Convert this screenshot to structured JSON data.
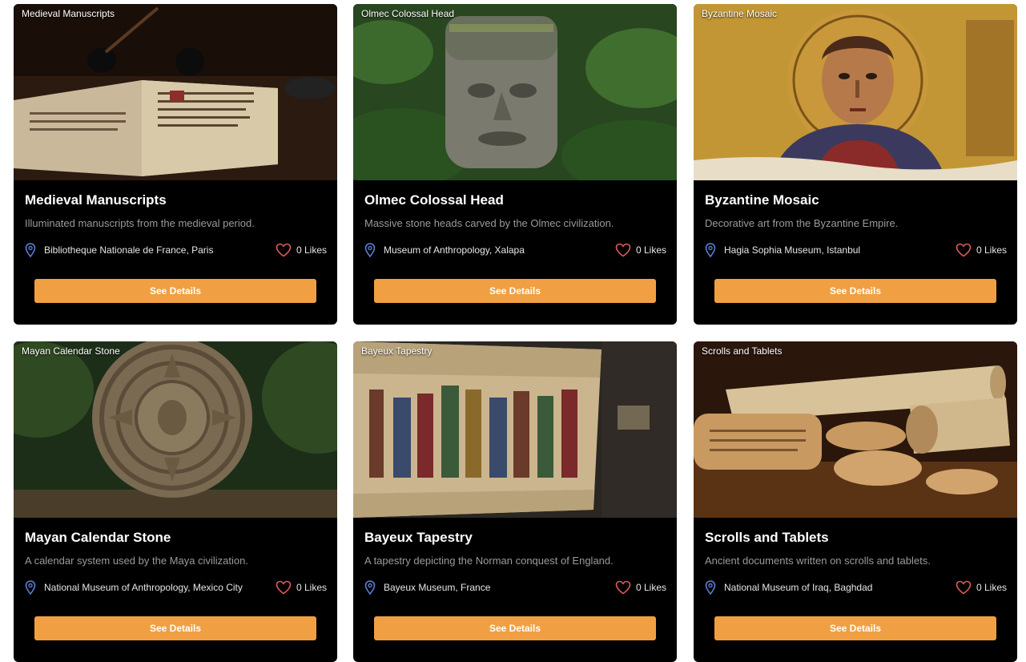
{
  "cards": [
    {
      "tag": "Medieval Manuscripts",
      "title": "Medieval Manuscripts",
      "description": "Illuminated manuscripts from the medieval period.",
      "location": "Bibliotheque Nationale de France, Paris",
      "likes": "0 Likes",
      "button": "See Details"
    },
    {
      "tag": "Olmec Colossal Head",
      "title": "Olmec Colossal Head",
      "description": "Massive stone heads carved by the Olmec civilization.",
      "location": "Museum of Anthropology, Xalapa",
      "likes": "0 Likes",
      "button": "See Details"
    },
    {
      "tag": "Byzantine Mosaic",
      "title": "Byzantine Mosaic",
      "description": "Decorative art from the Byzantine Empire.",
      "location": "Hagia Sophia Museum, Istanbul",
      "likes": "0 Likes",
      "button": "See Details"
    },
    {
      "tag": "Mayan Calendar Stone",
      "title": "Mayan Calendar Stone",
      "description": "A calendar system used by the Maya civilization.",
      "location": "National Museum of Anthropology, Mexico City",
      "likes": "0 Likes",
      "button": "See Details"
    },
    {
      "tag": "Bayeux Tapestry",
      "title": "Bayeux Tapestry",
      "description": "A tapestry depicting the Norman conquest of England.",
      "location": "Bayeux Museum, France",
      "likes": "0 Likes",
      "button": "See Details"
    },
    {
      "tag": "Scrolls and Tablets",
      "title": "Scrolls and Tablets",
      "description": "Ancient documents written on scrolls and tablets.",
      "location": "National Museum of Iraq, Baghdad",
      "likes": "0 Likes",
      "button": "See Details"
    }
  ],
  "colors": {
    "card_bg": "#000000",
    "button_bg": "#f0a042",
    "pin": "#5b7fd6",
    "heart": "#e05a5a"
  },
  "icons": {
    "location": "map-pin-icon",
    "like": "heart-icon"
  }
}
